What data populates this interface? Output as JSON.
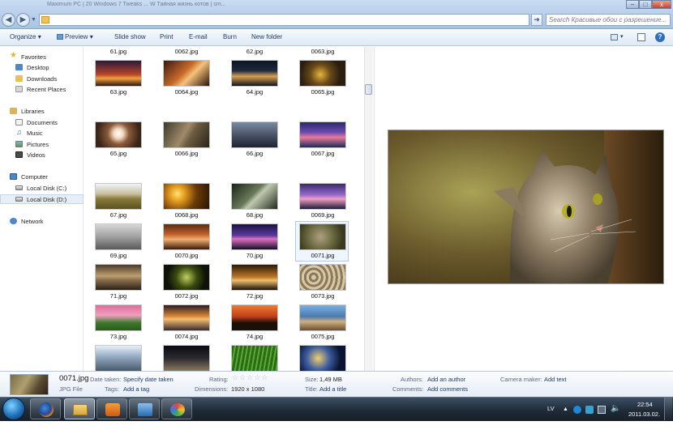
{
  "window": {
    "search_placeholder": "Search Красивые обои с разрешение...",
    "tab_strip_text": "Maximum PC | 20 Windows 7 Tweaks ...   W   Тайная жизнь котов | sm...",
    "controls": {
      "minimize": "–",
      "maximize": "□",
      "close": "x"
    }
  },
  "toolbar": {
    "organize": "Organize",
    "preview": "Preview",
    "slideshow": "Slide show",
    "print": "Print",
    "email": "E-mail",
    "burn": "Burn",
    "new_folder": "New folder"
  },
  "nav": {
    "favorites": "Favorites",
    "desktop": "Desktop",
    "downloads": "Downloads",
    "recent": "Recent Places",
    "libraries": "Libraries",
    "documents": "Documents",
    "music": "Music",
    "pictures": "Pictures",
    "videos": "Videos",
    "computer": "Computer",
    "disk_c": "Local Disk (C:)",
    "disk_d": "Local Disk (D:)",
    "network": "Network"
  },
  "files": {
    "top_row": [
      "61.jpg",
      "0062.jpg",
      "62.jpg",
      "0063.jpg"
    ],
    "rows": [
      [
        "63.jpg",
        "0064.jpg",
        "64.jpg",
        "0065.jpg"
      ],
      [
        "65.jpg",
        "0066.jpg",
        "66.jpg",
        "0067.jpg"
      ],
      [
        "67.jpg",
        "0068.jpg",
        "68.jpg",
        "0069.jpg"
      ],
      [
        "69.jpg",
        "0070.jpg",
        "70.jpg",
        "0071.jpg"
      ],
      [
        "71.jpg",
        "0072.jpg",
        "72.jpg",
        "0073.jpg"
      ],
      [
        "73.jpg",
        "0074.jpg",
        "74.jpg",
        "0075.jpg"
      ]
    ],
    "selected": "0071.jpg"
  },
  "details": {
    "filename": "0071.jpg",
    "filetype": "JPG File",
    "date_taken_label": "Date taken:",
    "date_taken_value": "Specify date taken",
    "tags_label": "Tags:",
    "tags_value": "Add a tag",
    "rating_label": "Rating:",
    "rating_value": 0,
    "dimensions_label": "Dimensions:",
    "dimensions_value": "1920 x 1080",
    "size_label": "Size:",
    "size_value": "1,49 MB",
    "title_label": "Title:",
    "title_value": "Add a title",
    "authors_label": "Authors:",
    "authors_value": "Add an author",
    "comments_label": "Comments:",
    "comments_value": "Add comments",
    "camera_label": "Camera maker:",
    "camera_value": "Add text"
  },
  "taskbar": {
    "lang": "LV",
    "time": "22:54",
    "date": "2011.03.02."
  }
}
